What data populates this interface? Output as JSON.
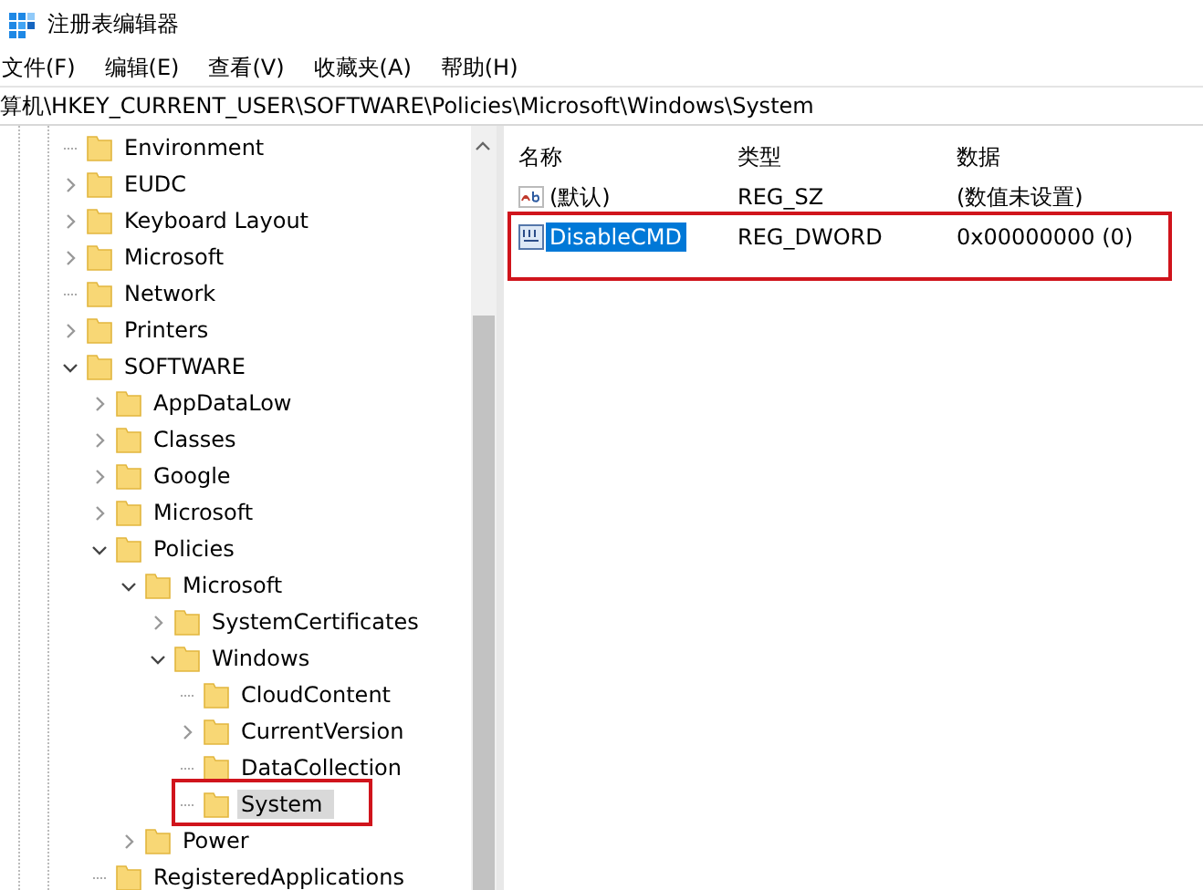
{
  "window": {
    "title": "注册表编辑器"
  },
  "menu": [
    "文件(F)",
    "编辑(E)",
    "查看(V)",
    "收藏夹(A)",
    "帮助(H)"
  ],
  "address": "算机\\HKEY_CURRENT_USER\\SOFTWARE\\Policies\\Microsoft\\Windows\\System",
  "tree": [
    {
      "name": "Environment",
      "kind": "leaf",
      "selected": false
    },
    {
      "name": "EUDC",
      "kind": "branch",
      "expanded": false,
      "selected": false
    },
    {
      "name": "Keyboard Layout",
      "kind": "branch",
      "expanded": false,
      "selected": false
    },
    {
      "name": "Microsoft",
      "kind": "branch",
      "expanded": false,
      "selected": false
    },
    {
      "name": "Network",
      "kind": "leaf",
      "selected": false
    },
    {
      "name": "Printers",
      "kind": "branch",
      "expanded": false,
      "selected": false
    },
    {
      "name": "SOFTWARE",
      "kind": "branch",
      "expanded": true,
      "selected": false,
      "children": [
        {
          "name": "AppDataLow",
          "kind": "branch",
          "expanded": false,
          "selected": false
        },
        {
          "name": "Classes",
          "kind": "branch",
          "expanded": false,
          "selected": false
        },
        {
          "name": "Google",
          "kind": "branch",
          "expanded": false,
          "selected": false
        },
        {
          "name": "Microsoft",
          "kind": "branch",
          "expanded": false,
          "selected": false
        },
        {
          "name": "Policies",
          "kind": "branch",
          "expanded": true,
          "selected": false,
          "children": [
            {
              "name": "Microsoft",
              "kind": "branch",
              "expanded": true,
              "selected": false,
              "children": [
                {
                  "name": "SystemCertificates",
                  "kind": "branch",
                  "expanded": false,
                  "selected": false
                },
                {
                  "name": "Windows",
                  "kind": "branch",
                  "expanded": true,
                  "selected": false,
                  "children": [
                    {
                      "name": "CloudContent",
                      "kind": "leaf",
                      "selected": false
                    },
                    {
                      "name": "CurrentVersion",
                      "kind": "branch",
                      "expanded": false,
                      "selected": false
                    },
                    {
                      "name": "DataCollection",
                      "kind": "leaf",
                      "selected": false
                    },
                    {
                      "name": "System",
                      "kind": "leaf",
                      "selected": true
                    }
                  ]
                }
              ]
            },
            {
              "name": "Power",
              "kind": "branch",
              "expanded": false,
              "selected": false
            }
          ]
        },
        {
          "name": "RegisteredApplications",
          "kind": "leaf",
          "selected": false
        }
      ]
    }
  ],
  "table": {
    "columns": [
      "名称",
      "类型",
      "数据"
    ],
    "rows": [
      {
        "kind": "string",
        "name": "(默认)",
        "type": "REG_SZ",
        "data": "(数值未设置)",
        "selected": false
      },
      {
        "kind": "binary",
        "name": "DisableCMD",
        "type": "REG_DWORD",
        "data": "0x00000000 (0)",
        "selected": true
      }
    ]
  }
}
